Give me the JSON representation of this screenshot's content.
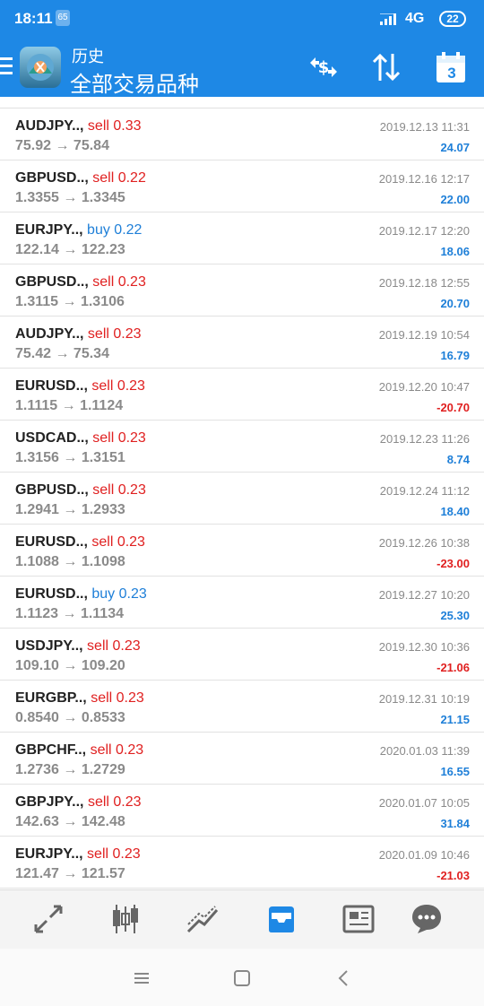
{
  "status_bar": {
    "time": "18:11",
    "notification_badge": "65",
    "network": "4G",
    "battery": "22"
  },
  "app_bar": {
    "title": "历史",
    "subtitle": "全部交易品种",
    "calendar_day": "3",
    "accent_color": "#1e88e5"
  },
  "rows": [
    {
      "symbol": "AUDJPY..,",
      "side": "sell",
      "volume": "sell 0.33",
      "prices": "75.92 → 75.84",
      "time": "2019.12.13 11:31",
      "profit": "24.07",
      "profit_sign": "pos"
    },
    {
      "symbol": "GBPUSD..,",
      "side": "sell",
      "volume": "sell 0.22",
      "prices": "1.3355 → 1.3345",
      "time": "2019.12.16 12:17",
      "profit": "22.00",
      "profit_sign": "pos"
    },
    {
      "symbol": "EURJPY..,",
      "side": "buy",
      "volume": "buy 0.22",
      "prices": "122.14 → 122.23",
      "time": "2019.12.17 12:20",
      "profit": "18.06",
      "profit_sign": "pos"
    },
    {
      "symbol": "GBPUSD..,",
      "side": "sell",
      "volume": "sell 0.23",
      "prices": "1.3115 → 1.3106",
      "time": "2019.12.18 12:55",
      "profit": "20.70",
      "profit_sign": "pos"
    },
    {
      "symbol": "AUDJPY..,",
      "side": "sell",
      "volume": "sell 0.23",
      "prices": "75.42 → 75.34",
      "time": "2019.12.19 10:54",
      "profit": "16.79",
      "profit_sign": "pos"
    },
    {
      "symbol": "EURUSD..,",
      "side": "sell",
      "volume": "sell 0.23",
      "prices": "1.1115 → 1.1124",
      "time": "2019.12.20 10:47",
      "profit": "-20.70",
      "profit_sign": "neg"
    },
    {
      "symbol": "USDCAD..,",
      "side": "sell",
      "volume": "sell 0.23",
      "prices": "1.3156 → 1.3151",
      "time": "2019.12.23 11:26",
      "profit": "8.74",
      "profit_sign": "pos"
    },
    {
      "symbol": "GBPUSD..,",
      "side": "sell",
      "volume": "sell 0.23",
      "prices": "1.2941 → 1.2933",
      "time": "2019.12.24 11:12",
      "profit": "18.40",
      "profit_sign": "pos"
    },
    {
      "symbol": "EURUSD..,",
      "side": "sell",
      "volume": "sell 0.23",
      "prices": "1.1088 → 1.1098",
      "time": "2019.12.26 10:38",
      "profit": "-23.00",
      "profit_sign": "neg"
    },
    {
      "symbol": "EURUSD..,",
      "side": "buy",
      "volume": "buy 0.23",
      "prices": "1.1123 → 1.1134",
      "time": "2019.12.27 10:20",
      "profit": "25.30",
      "profit_sign": "pos"
    },
    {
      "symbol": "USDJPY..,",
      "side": "sell",
      "volume": "sell 0.23",
      "prices": "109.10 → 109.20",
      "time": "2019.12.30 10:36",
      "profit": "-21.06",
      "profit_sign": "neg"
    },
    {
      "symbol": "EURGBP..,",
      "side": "sell",
      "volume": "sell 0.23",
      "prices": "0.8540 → 0.8533",
      "time": "2019.12.31 10:19",
      "profit": "21.15",
      "profit_sign": "pos"
    },
    {
      "symbol": "GBPCHF..,",
      "side": "sell",
      "volume": "sell 0.23",
      "prices": "1.2736 → 1.2729",
      "time": "2020.01.03 11:39",
      "profit": "16.55",
      "profit_sign": "pos"
    },
    {
      "symbol": "GBPJPY..,",
      "side": "sell",
      "volume": "sell 0.23",
      "prices": "142.63 → 142.48",
      "time": "2020.01.07 10:05",
      "profit": "31.84",
      "profit_sign": "pos"
    },
    {
      "symbol": "EURJPY..,",
      "side": "sell",
      "volume": "sell 0.23",
      "prices": "121.47 → 121.57",
      "time": "2020.01.09 10:46",
      "profit": "-21.03",
      "profit_sign": "neg"
    }
  ],
  "bottom_nav": {
    "items": [
      "quotes-icon",
      "chart-icon",
      "trade-icon",
      "history-icon",
      "news-icon",
      "chat-icon"
    ],
    "active_index": 3
  },
  "system_nav": [
    "menu-key-icon",
    "home-key-icon",
    "back-key-icon"
  ]
}
